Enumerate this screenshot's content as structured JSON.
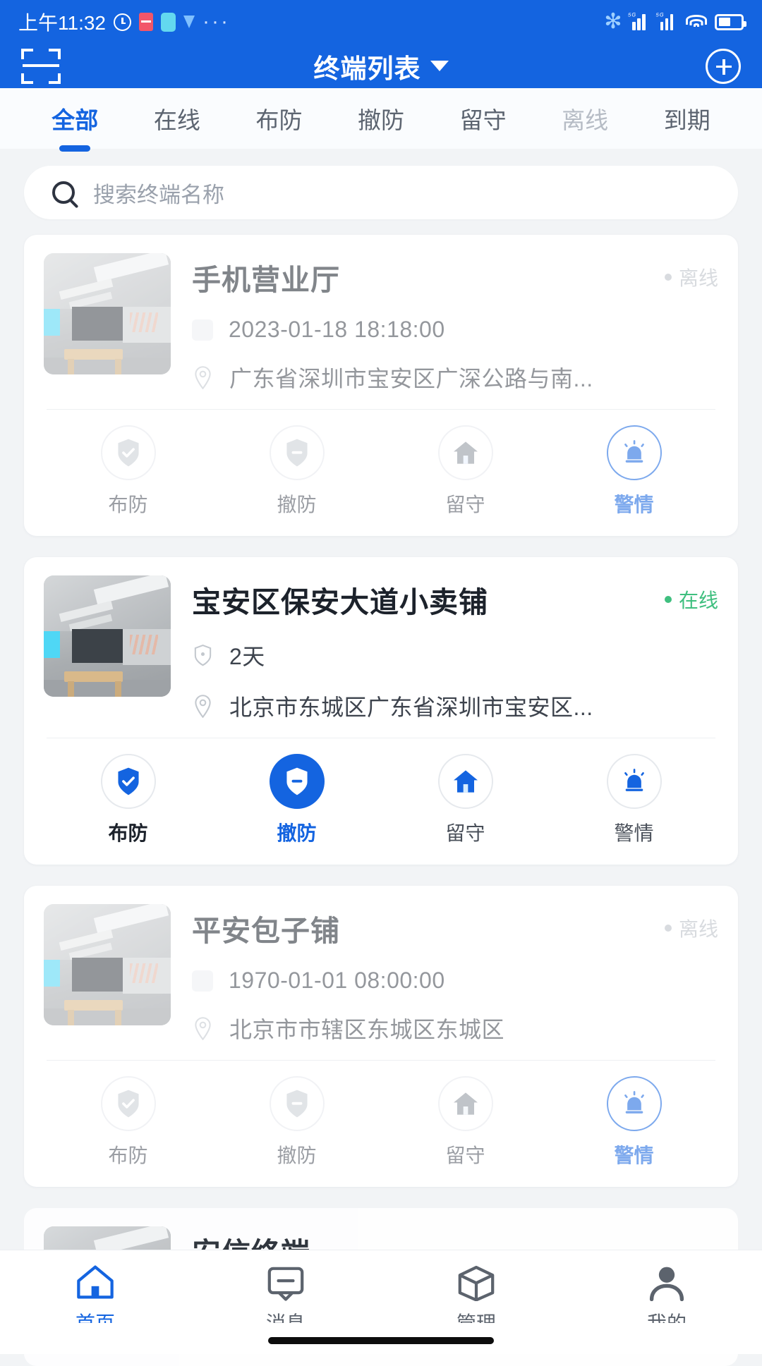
{
  "status_bar": {
    "time": "上午11:32",
    "icons": [
      "alarm-icon",
      "red-app-icon",
      "cyan-app-icon",
      "drop-icon",
      "more-dots-icon",
      "bluetooth-icon",
      "signal-1-icon",
      "signal-2-icon",
      "wifi-icon",
      "battery-icon"
    ],
    "bluetooth_glyph": "✻"
  },
  "header": {
    "scan_icon": "scan-icon",
    "title": "终端列表",
    "caret": "chevron-down-icon",
    "add_label": "add-icon"
  },
  "tabs": {
    "items": [
      {
        "label": "全部",
        "active": true
      },
      {
        "label": "在线",
        "active": false
      },
      {
        "label": "布防",
        "active": false
      },
      {
        "label": "撤防",
        "active": false
      },
      {
        "label": "留守",
        "active": false
      },
      {
        "label": "离线",
        "active": false
      },
      {
        "label": "到期",
        "active": false
      }
    ]
  },
  "search": {
    "placeholder": "搜索终端名称",
    "value": "",
    "icon": "search-icon"
  },
  "cards": [
    {
      "title": "手机营业厅",
      "status": "离线",
      "status_type": "offline",
      "meta_icon": "calendar-icon",
      "meta_text": "2023-01-18 18:18:00",
      "addr_icon": "location-pin-icon",
      "address": "广东省深圳市宝安区广深公路与南...",
      "dimmed": true,
      "actions": [
        {
          "label": "布防",
          "icon": "shield-check-icon",
          "active": false
        },
        {
          "label": "撤防",
          "icon": "shield-minus-icon",
          "active": false
        },
        {
          "label": "留守",
          "icon": "house-icon",
          "active": false
        },
        {
          "label": "警情",
          "icon": "alarm-siren-icon",
          "active": false
        }
      ]
    },
    {
      "title": "宝安区保安大道小卖铺",
      "status": "在线",
      "status_type": "online",
      "meta_icon": "shield-icon",
      "meta_text": "2天",
      "addr_icon": "location-pin-icon",
      "address": "北京市东城区广东省深圳市宝安区...",
      "dimmed": false,
      "actions": [
        {
          "label": "布防",
          "icon": "shield-check-icon",
          "active": false
        },
        {
          "label": "撤防",
          "icon": "shield-minus-icon",
          "active": true
        },
        {
          "label": "留守",
          "icon": "house-icon",
          "active": false
        },
        {
          "label": "警情",
          "icon": "alarm-siren-icon",
          "active": false
        }
      ]
    },
    {
      "title": "平安包子铺",
      "status": "离线",
      "status_type": "offline",
      "meta_icon": "calendar-icon",
      "meta_text": "1970-01-01 08:00:00",
      "addr_icon": "location-pin-icon",
      "address": "北京市市辖区东城区东城区",
      "dimmed": true,
      "actions": [
        {
          "label": "布防",
          "icon": "shield-check-icon",
          "active": false
        },
        {
          "label": "撤防",
          "icon": "shield-minus-icon",
          "active": false
        },
        {
          "label": "留守",
          "icon": "house-icon",
          "active": false
        },
        {
          "label": "警情",
          "icon": "alarm-siren-icon",
          "active": false
        }
      ]
    }
  ],
  "partial_card": {
    "title": "安信终端"
  },
  "bottom_nav": {
    "items": [
      {
        "label": "首页",
        "icon": "home-icon",
        "active": true
      },
      {
        "label": "消息",
        "icon": "message-icon",
        "active": false
      },
      {
        "label": "管理",
        "icon": "box-icon",
        "active": false
      },
      {
        "label": "我的",
        "icon": "person-icon",
        "active": false
      }
    ]
  },
  "colors": {
    "brand": "#1464e0",
    "online": "#3fbf7f",
    "offline": "#b9bec6",
    "page_bg": "#f2f4f6"
  }
}
